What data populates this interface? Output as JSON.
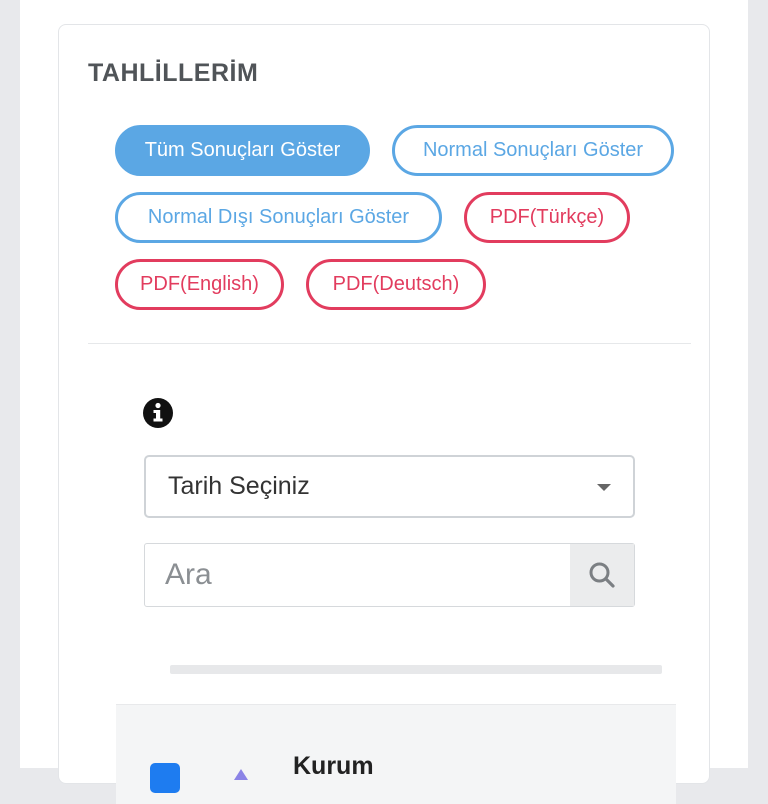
{
  "card": {
    "title": "TAHLİLLERİM"
  },
  "filters": {
    "all": "Tüm Sonuçları Göster",
    "normal": "Normal Sonuçları Göster",
    "abnormal": "Normal Dışı Sonuçları Göster",
    "pdf_tr": "PDF(Türkçe)",
    "pdf_en": "PDF(English)",
    "pdf_de": "PDF(Deutsch)"
  },
  "date_select": {
    "selected": "Tarih Seçiniz"
  },
  "search": {
    "placeholder": "Ara"
  },
  "table": {
    "header_label": "Kurum"
  },
  "colors": {
    "accent_blue": "#5ba7e4",
    "pdf_red": "#e23c5e",
    "checkbox_blue": "#1e7cf0"
  },
  "icons": [
    "info-icon",
    "chevron-down-icon",
    "search-icon",
    "sort-up-icon",
    "checkbox-checked-icon"
  ]
}
